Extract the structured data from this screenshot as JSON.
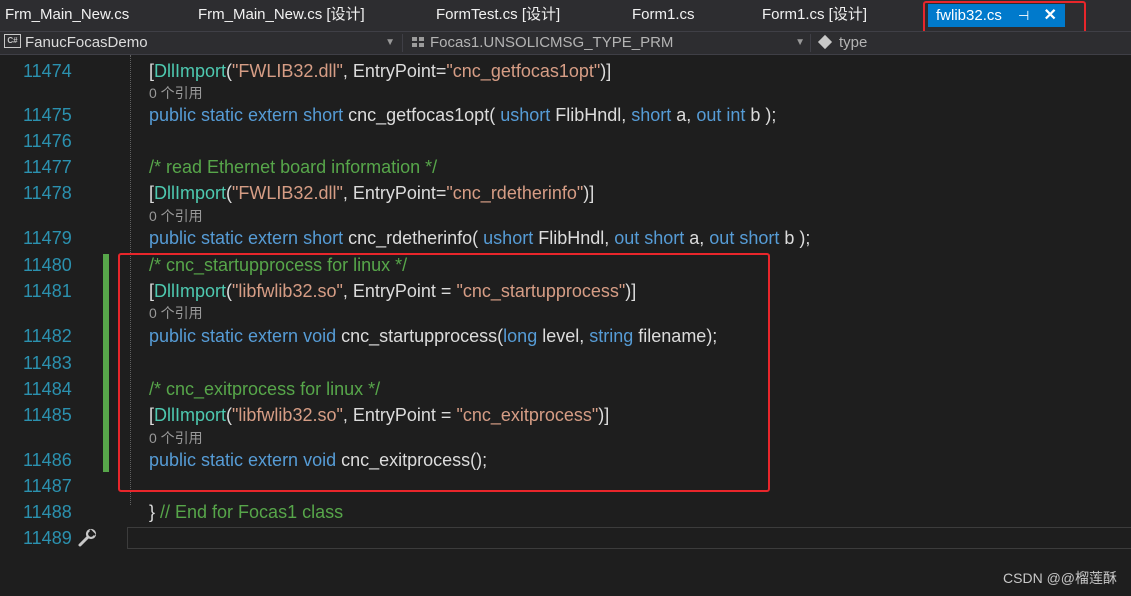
{
  "tabs": [
    {
      "label": "Frm_Main_New.cs",
      "active": false
    },
    {
      "label": "Frm_Main_New.cs [设计]",
      "active": false
    },
    {
      "label": "FormTest.cs [设计]",
      "active": false
    },
    {
      "label": "Form1.cs",
      "active": false
    },
    {
      "label": "Form1.cs [设计]",
      "active": false
    },
    {
      "label": "fwlib32.cs",
      "active": true
    }
  ],
  "active_tab": {
    "pin_glyph": "⊣",
    "close_glyph": "✕"
  },
  "nav": {
    "project": "FanucFocasDemo",
    "class": "Focas1.UNSOLICMSG_TYPE_PRM",
    "member": "type"
  },
  "lines": [
    {
      "num": "11474",
      "lens": "0 个引用",
      "tokens": [
        {
          "t": "[",
          "c": ""
        },
        {
          "t": "DllImport",
          "c": "ty"
        },
        {
          "t": "(",
          "c": ""
        },
        {
          "t": "\"FWLIB32.dll\"",
          "c": "st"
        },
        {
          "t": ", EntryPoint=",
          "c": ""
        },
        {
          "t": "\"cnc_getfocas1opt\"",
          "c": "st"
        },
        {
          "t": ")]",
          "c": ""
        }
      ]
    },
    {
      "num": "11475",
      "lens": "",
      "tokens": [
        {
          "t": "public static extern short ",
          "c": "kw"
        },
        {
          "t": "cnc_getfocas1opt( ",
          "c": ""
        },
        {
          "t": "ushort ",
          "c": "kw"
        },
        {
          "t": "FlibHndl, ",
          "c": ""
        },
        {
          "t": "short ",
          "c": "kw"
        },
        {
          "t": "a, ",
          "c": ""
        },
        {
          "t": "out int ",
          "c": "kw"
        },
        {
          "t": "b );",
          "c": ""
        }
      ]
    },
    {
      "num": "11476",
      "lens": "",
      "tokens": []
    },
    {
      "num": "11477",
      "lens": "",
      "tokens": [
        {
          "t": "/* read Ethernet board information */",
          "c": "cm"
        }
      ]
    },
    {
      "num": "11478",
      "lens": "0 个引用",
      "tokens": [
        {
          "t": "[",
          "c": ""
        },
        {
          "t": "DllImport",
          "c": "ty"
        },
        {
          "t": "(",
          "c": ""
        },
        {
          "t": "\"FWLIB32.dll\"",
          "c": "st"
        },
        {
          "t": ", EntryPoint=",
          "c": ""
        },
        {
          "t": "\"cnc_rdetherinfo\"",
          "c": "st"
        },
        {
          "t": ")]",
          "c": ""
        }
      ]
    },
    {
      "num": "11479",
      "lens": "",
      "tokens": [
        {
          "t": "public static extern short ",
          "c": "kw"
        },
        {
          "t": "cnc_rdetherinfo( ",
          "c": ""
        },
        {
          "t": "ushort ",
          "c": "kw"
        },
        {
          "t": "FlibHndl, ",
          "c": ""
        },
        {
          "t": "out short ",
          "c": "kw"
        },
        {
          "t": "a, ",
          "c": ""
        },
        {
          "t": "out short ",
          "c": "kw"
        },
        {
          "t": "b );",
          "c": ""
        }
      ]
    },
    {
      "num": "11480",
      "lens": "",
      "tokens": [
        {
          "t": "/* cnc_startupprocess for linux */",
          "c": "cm"
        }
      ]
    },
    {
      "num": "11481",
      "lens": "0 个引用",
      "tokens": [
        {
          "t": "[",
          "c": ""
        },
        {
          "t": "DllImport",
          "c": "ty"
        },
        {
          "t": "(",
          "c": ""
        },
        {
          "t": "\"libfwlib32.so\"",
          "c": "st"
        },
        {
          "t": ", EntryPoint = ",
          "c": ""
        },
        {
          "t": "\"cnc_startupprocess\"",
          "c": "st"
        },
        {
          "t": ")]",
          "c": ""
        }
      ]
    },
    {
      "num": "11482",
      "lens": "",
      "tokens": [
        {
          "t": "public static extern void ",
          "c": "kw"
        },
        {
          "t": "cnc_startupprocess(",
          "c": ""
        },
        {
          "t": "long ",
          "c": "kw"
        },
        {
          "t": "level, ",
          "c": ""
        },
        {
          "t": "string ",
          "c": "kw"
        },
        {
          "t": "filename);",
          "c": ""
        }
      ]
    },
    {
      "num": "11483",
      "lens": "",
      "tokens": []
    },
    {
      "num": "11484",
      "lens": "",
      "tokens": [
        {
          "t": "/* cnc_exitprocess for linux */",
          "c": "cm"
        }
      ]
    },
    {
      "num": "11485",
      "lens": "0 个引用",
      "tokens": [
        {
          "t": "[",
          "c": ""
        },
        {
          "t": "DllImport",
          "c": "ty"
        },
        {
          "t": "(",
          "c": ""
        },
        {
          "t": "\"libfwlib32.so\"",
          "c": "st"
        },
        {
          "t": ", EntryPoint = ",
          "c": ""
        },
        {
          "t": "\"cnc_exitprocess\"",
          "c": "st"
        },
        {
          "t": ")]",
          "c": ""
        }
      ]
    },
    {
      "num": "11486",
      "lens": "",
      "tokens": [
        {
          "t": "public static extern void ",
          "c": "kw"
        },
        {
          "t": "cnc_exitprocess();",
          "c": ""
        }
      ]
    },
    {
      "num": "11487",
      "lens": "",
      "tokens": []
    },
    {
      "num": "11488",
      "lens": "",
      "tokens": [
        {
          "t": "} ",
          "c": ""
        },
        {
          "t": "// End for Focas1 class",
          "c": "cm"
        }
      ]
    },
    {
      "num": "11489",
      "lens": "",
      "tokens": []
    }
  ],
  "watermark": "CSDN @@榴莲酥",
  "colors": {
    "highlight_box": "#e8262b",
    "active_tab": "#007acc",
    "line_number": "#2b91af",
    "keyword": "#569cd6",
    "type": "#4ec9b0",
    "string": "#d69d85",
    "comment": "#57a64a",
    "change_bar": "#57a64a"
  },
  "icons": {
    "project": "csharp-project-icon",
    "class": "struct-icon",
    "member": "field-cube-icon",
    "gutter": "wrench-icon"
  }
}
